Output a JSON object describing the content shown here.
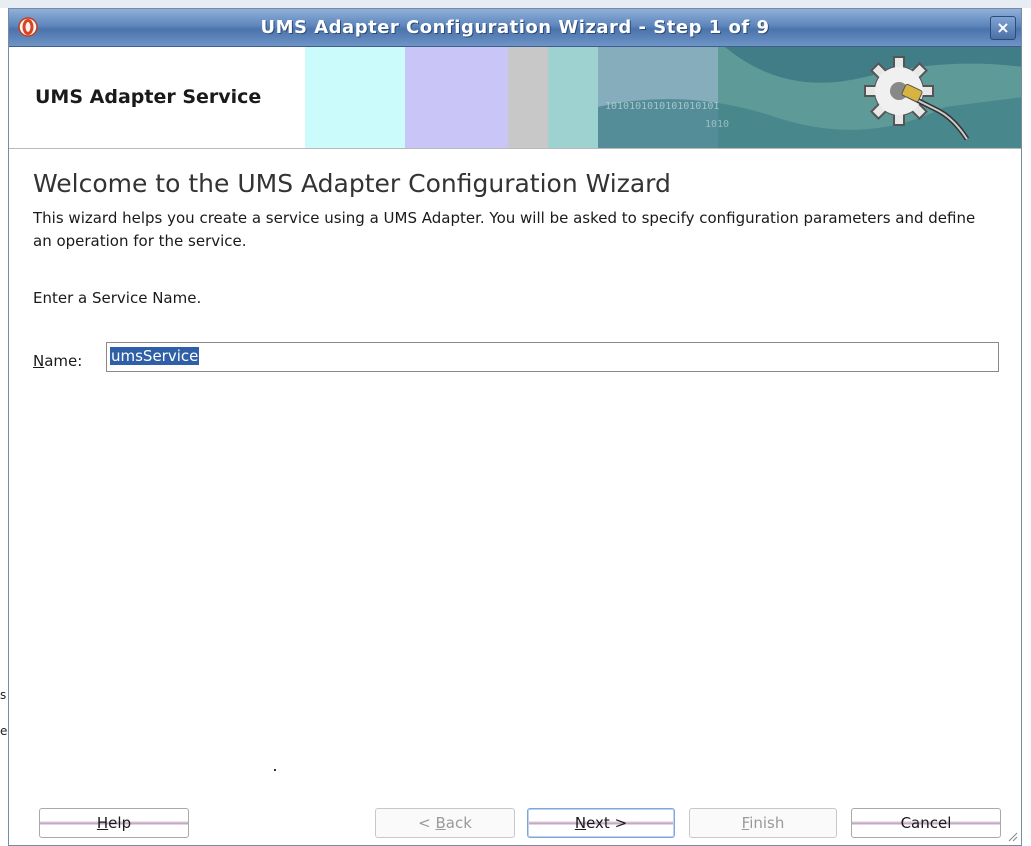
{
  "window": {
    "title": "UMS Adapter Configuration Wizard - Step 1 of 9",
    "close_glyph": "×"
  },
  "header": {
    "title": "UMS Adapter Service",
    "banner_icon": "gear-plug-icon"
  },
  "content": {
    "welcome_title": "Welcome to the UMS Adapter Configuration Wizard",
    "description": "This wizard helps you create a service using a UMS Adapter. You will be asked to specify configuration parameters and define an operation for the service.",
    "prompt": "Enter a Service Name.",
    "name_label_mnemonic": "N",
    "name_label_rest": "ame:",
    "name_value": "umsService"
  },
  "buttons": {
    "help_mnemonic": "H",
    "help_rest": "elp",
    "back_prefix": "< ",
    "back_mnemonic": "B",
    "back_rest": "ack",
    "next_mnemonic": "N",
    "next_rest": "ext >",
    "finish_mnemonic": "F",
    "finish_rest": "inish",
    "cancel_label": "Cancel"
  },
  "background_fragments": [
    "s",
    "e"
  ],
  "colors": {
    "titlebar": "#5d86bd",
    "selection": "#2f5fa7",
    "banner_cyan": "#ccfbfc",
    "banner_lavender": "#c9c6f7",
    "banner_teal": "#4c8f8f"
  }
}
